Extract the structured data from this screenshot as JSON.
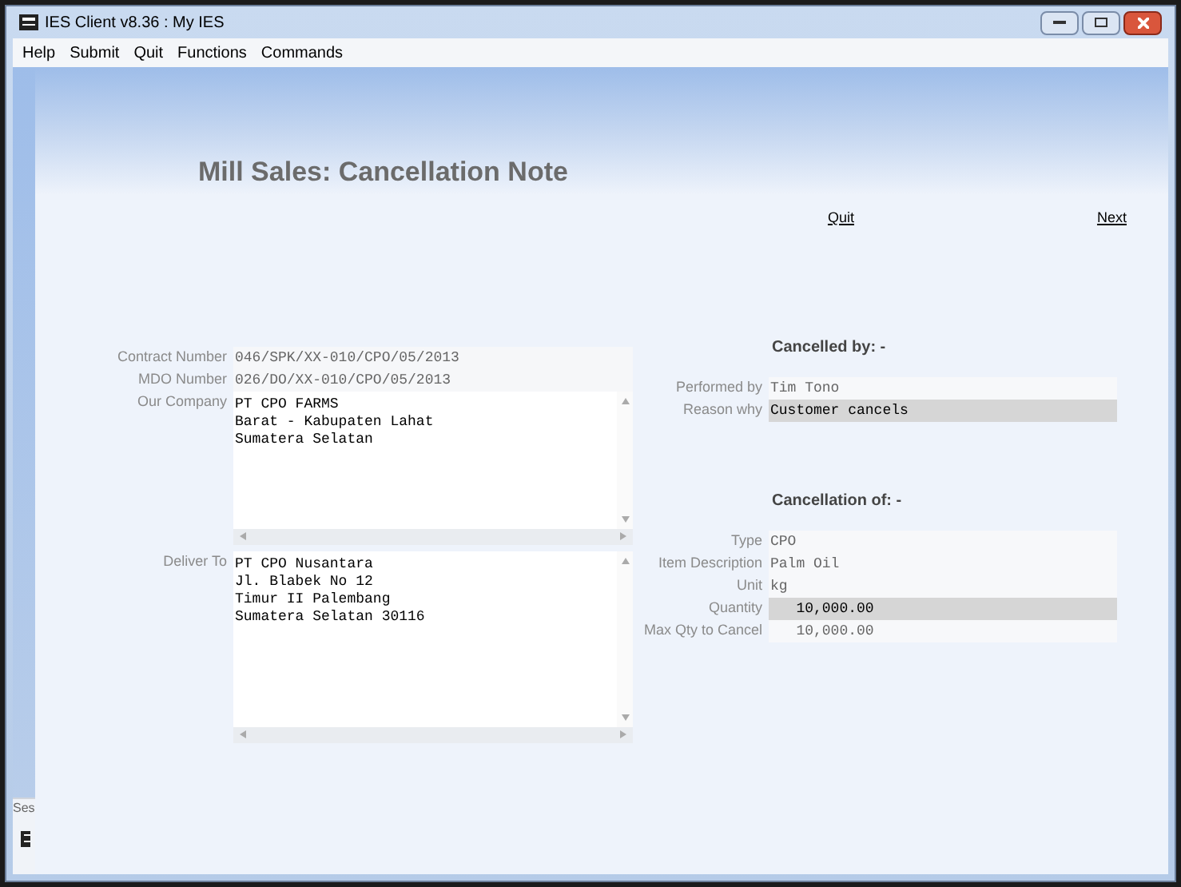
{
  "window": {
    "title": "IES Client v8.36 : My IES"
  },
  "menu": [
    "Help",
    "Submit",
    "Quit",
    "Functions",
    "Commands"
  ],
  "page_title": "Mill Sales: Cancellation Note",
  "links": [
    "Quit",
    "Next"
  ],
  "left_fields": [
    {
      "label": "Contract Number",
      "kind": "line",
      "value": "046/SPK/XX-010/CPO/05/2013"
    },
    {
      "label": "MDO Number",
      "kind": "line",
      "value": "026/DO/XX-010/CPO/05/2013"
    },
    {
      "label": "Our Company",
      "kind": "area",
      "lines": [
        "PT CPO FARMS",
        "Barat - Kabupaten Lahat",
        "Sumatera Selatan"
      ]
    },
    {
      "label": "Deliver To",
      "kind": "area",
      "lines": [
        "PT CPO Nusantara",
        "Jl. Blabek No 12",
        "Timur II Palembang",
        "Sumatera Selatan 30116"
      ]
    }
  ],
  "sections": [
    {
      "heading": "Cancelled by: -",
      "fields": [
        {
          "label": "Performed by",
          "value": "Tim Tono",
          "highlighted": false
        },
        {
          "label": "Reason why",
          "value": "Customer cancels",
          "highlighted": true
        }
      ]
    },
    {
      "heading": "Cancellation of: -",
      "fields": [
        {
          "label": "Type",
          "value": "CPO",
          "highlighted": false
        },
        {
          "label": "Item Description",
          "value": "Palm Oil",
          "highlighted": false
        },
        {
          "label": "Unit",
          "value": "kg",
          "highlighted": false
        },
        {
          "label": "Quantity",
          "value": "   10,000.00",
          "highlighted": true
        },
        {
          "label": "Max Qty to Cancel",
          "value": "   10,000.00",
          "highlighted": false
        }
      ]
    }
  ],
  "side_tab": "Ses"
}
